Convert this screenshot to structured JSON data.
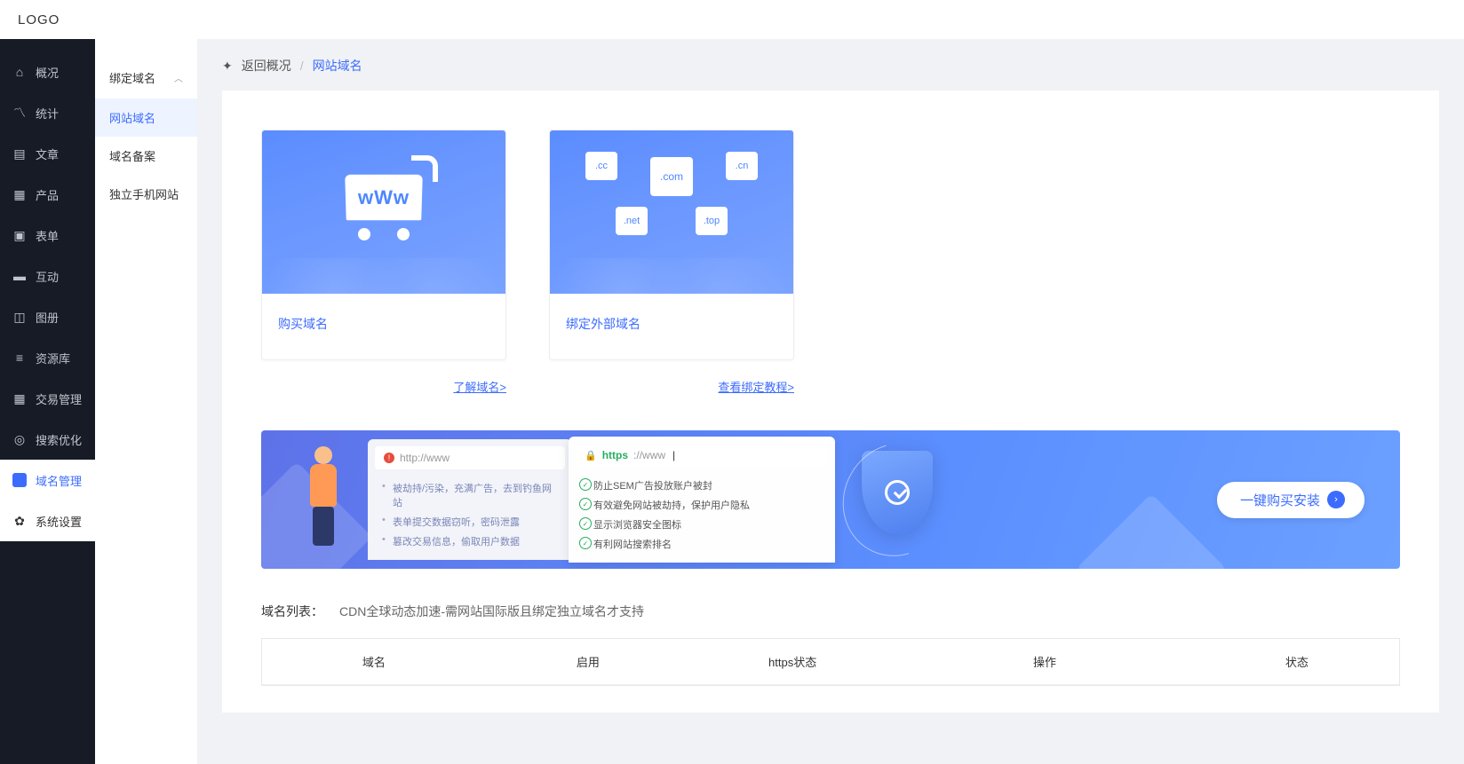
{
  "header": {
    "logo": "LOGO"
  },
  "sidebar": {
    "items": [
      {
        "label": "概况",
        "icon": "home"
      },
      {
        "label": "统计",
        "icon": "chart"
      },
      {
        "label": "文章",
        "icon": "doc"
      },
      {
        "label": "产品",
        "icon": "grid"
      },
      {
        "label": "表单",
        "icon": "form"
      },
      {
        "label": "互动",
        "icon": "chat"
      },
      {
        "label": "图册",
        "icon": "img"
      },
      {
        "label": "资源库",
        "icon": "db"
      },
      {
        "label": "交易管理",
        "icon": "trade"
      },
      {
        "label": "搜索优化",
        "icon": "search"
      },
      {
        "label": "域名管理",
        "icon": "domain"
      },
      {
        "label": "系统设置",
        "icon": "gear"
      }
    ]
  },
  "subsidebar": {
    "header": "绑定域名",
    "items": [
      {
        "label": "网站域名"
      },
      {
        "label": "域名备案"
      },
      {
        "label": "独立手机网站"
      }
    ]
  },
  "breadcrumb": {
    "back": "返回概况",
    "current": "网站域名"
  },
  "cards": [
    {
      "title": "购买域名",
      "link": "了解域名>",
      "www": "wWw"
    },
    {
      "title": "绑定外部域名",
      "link": "查看绑定教程>",
      "hex": {
        "cc": ".cc",
        "com": ".com",
        "cn": ".cn",
        "net": ".net",
        "top": ".top"
      }
    }
  ],
  "banner": {
    "left_addr": "http://www",
    "right_addr_proto": "https",
    "right_addr_rest": "://www",
    "left_list": [
      "被劫持/污染，充满广告，去到钓鱼网站",
      "表单提交数据窃听，密码泄露",
      "篡改交易信息，偷取用户数据"
    ],
    "right_list": [
      "防止SEM广告投放账户被封",
      "有效避免网站被劫持，保护用户隐私",
      "显示浏览器安全图标",
      "有利网站搜索排名"
    ],
    "button": "一键购买安装"
  },
  "domain_list": {
    "title": "域名列表：",
    "note": "CDN全球动态加速-需网站国际版且绑定独立域名才支持",
    "columns": [
      "域名",
      "启用",
      "https状态",
      "操作",
      "状态"
    ]
  }
}
